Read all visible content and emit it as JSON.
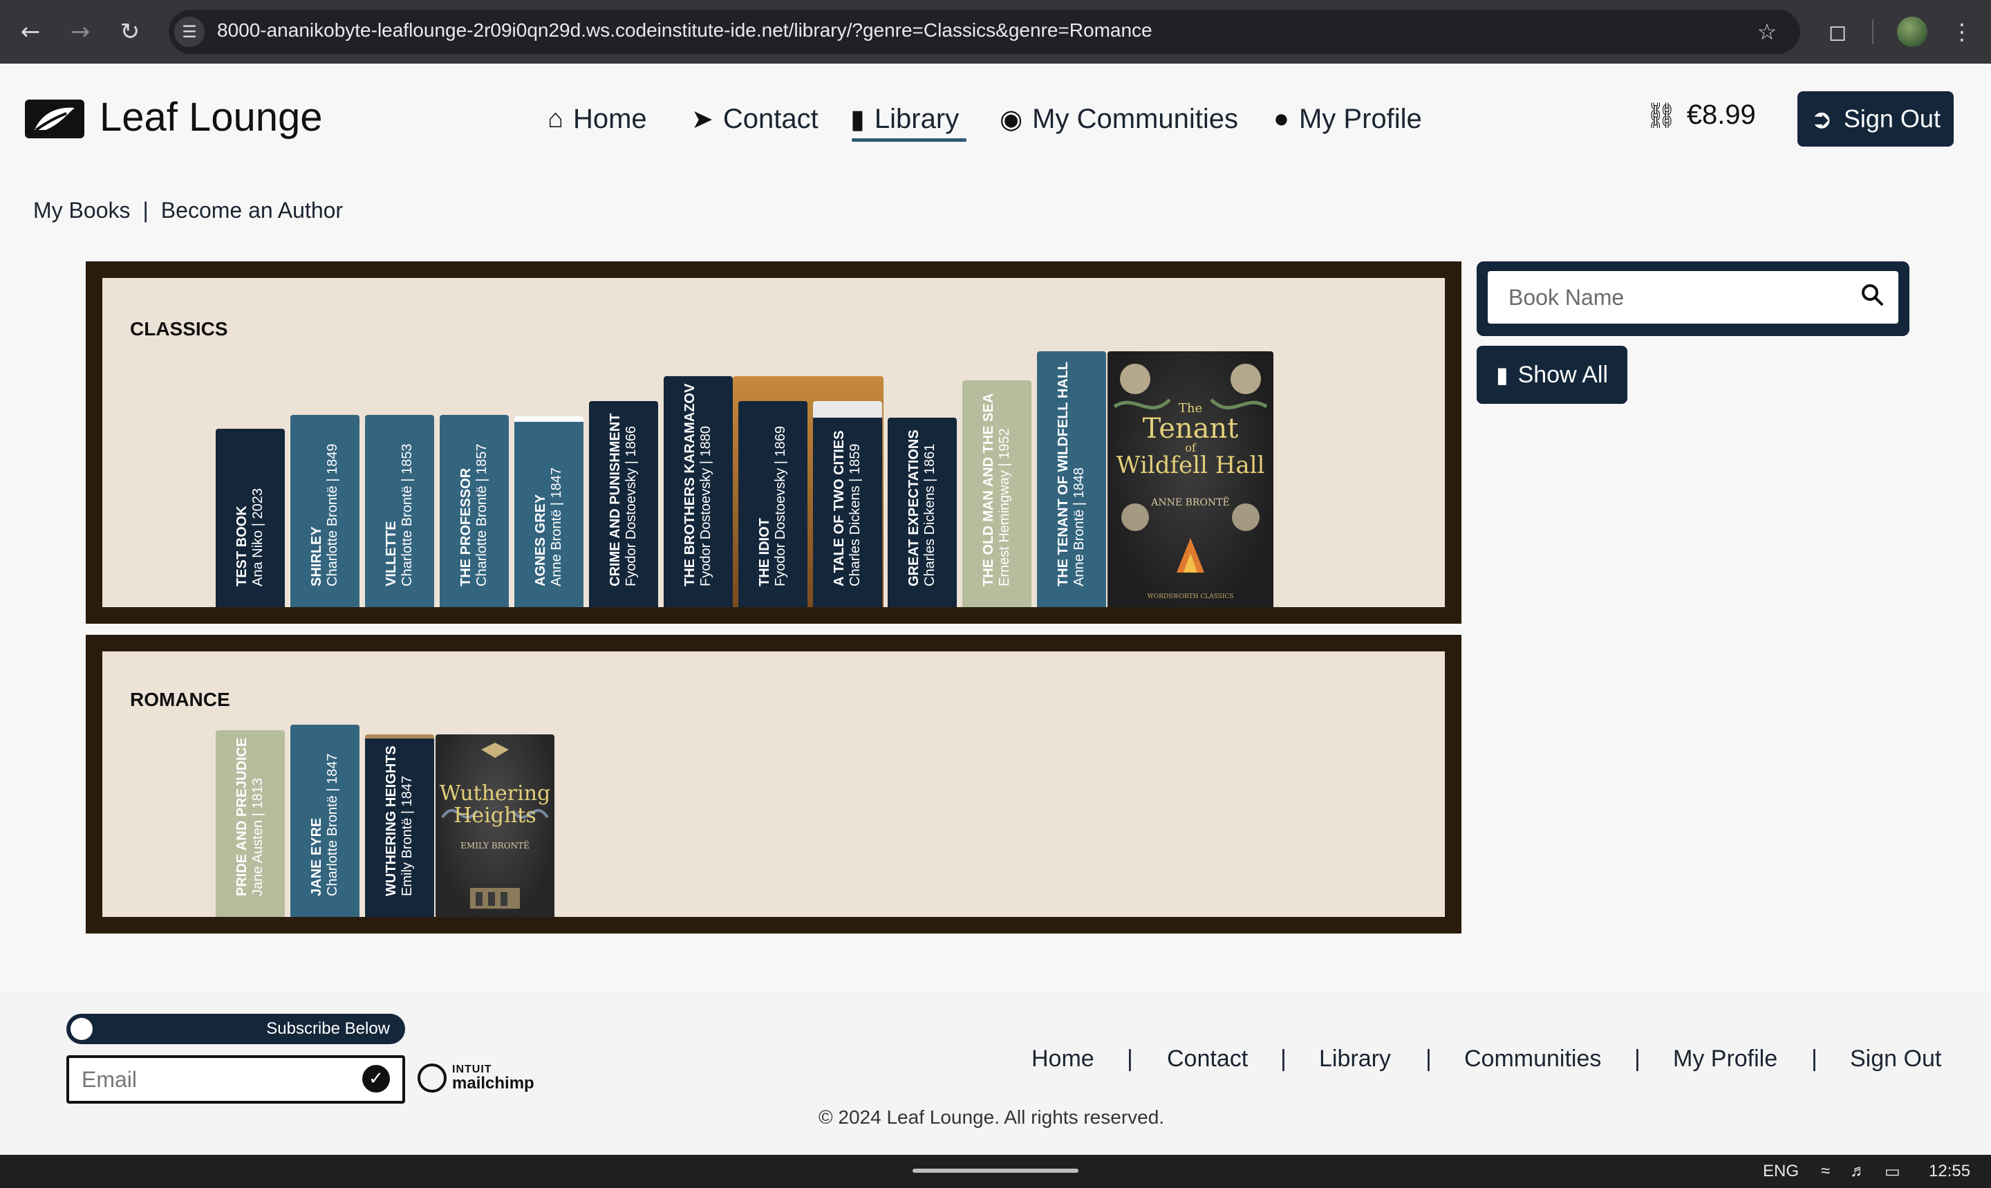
{
  "browser": {
    "url": "8000-ananikobyte-leaflounge-2r09i0qn29d.ws.codeinstitute-ide.net/library/?genre=Classics&genre=Romance"
  },
  "brand": {
    "name": "Leaf Lounge"
  },
  "nav": {
    "items": [
      {
        "label": "Home",
        "icon": "home-icon"
      },
      {
        "label": "Contact",
        "icon": "paper-plane-icon"
      },
      {
        "label": "Library",
        "icon": "book-icon"
      },
      {
        "label": "My Communities",
        "icon": "comments-icon"
      },
      {
        "label": "My Profile",
        "icon": "user-icon"
      }
    ],
    "active": "Library",
    "basket_total": "€8.99",
    "sign_out": "Sign Out"
  },
  "sub_links": {
    "my_books": "My Books",
    "separator": "|",
    "become_author": "Become an Author"
  },
  "shelves": [
    {
      "title": "CLASSICS",
      "books": [
        {
          "title": "TEST BOOK",
          "meta": "Ana Niko | 2023",
          "color": "#14263a"
        },
        {
          "title": "SHIRLEY",
          "meta": "Charlotte Brontë | 1849",
          "color": "#34657f"
        },
        {
          "title": "VILLETTE",
          "meta": "Charlotte Brontë | 1853",
          "color": "#34657f"
        },
        {
          "title": "THE PROFESSOR",
          "meta": "Charlotte Brontë | 1857",
          "color": "#34657f"
        },
        {
          "title": "AGNES GREY",
          "meta": "Anne Brontë | 1847",
          "color": "#34657f"
        },
        {
          "title": "CRIME AND PUNISHMENT",
          "meta": "Fyodor Dostoevsky | 1866",
          "color": "#14263a"
        },
        {
          "title": "THE BROTHERS KARAMAZOV",
          "meta": "Fyodor Dostoevsky | 1880",
          "color": "#14263a"
        },
        {
          "title": "THE IDIOT",
          "meta": "Fyodor Dostoevsky | 1869",
          "color": "#14263a"
        },
        {
          "title": "A TALE OF TWO CITIES",
          "meta": "Charles Dickens | 1859",
          "color": "#14263a"
        },
        {
          "title": "GREAT EXPECTATIONS",
          "meta": "Charles Dickens | 1861",
          "color": "#14263a"
        },
        {
          "title": "THE OLD MAN AND THE SEA",
          "meta": "Ernest Hemingway | 1952",
          "color": "#b5bd9d"
        },
        {
          "title": "THE TENANT OF WILDFELL HALL",
          "meta": "Anne Brontë | 1848",
          "color": "#34657f"
        }
      ],
      "cover": {
        "title_line1": "The",
        "title_line2": "Tenant",
        "title_line3": "of",
        "title_line4": "Wildfell Hall",
        "author": "ANNE BRONTË",
        "publisher": "WORDSWORTH CLASSICS"
      }
    },
    {
      "title": "ROMANCE",
      "books": [
        {
          "title": "PRIDE AND PREJUDICE",
          "meta": "Jane Austen | 1813",
          "color": "#b5bd9d"
        },
        {
          "title": "JANE EYRE",
          "meta": "Charlotte Brontë | 1847",
          "color": "#34657f"
        },
        {
          "title": "WUTHERING HEIGHTS",
          "meta": "Emily Brontë | 1847",
          "color": "#14263a"
        }
      ],
      "cover": {
        "title_line1": "Wuthering",
        "title_line2": "Heights",
        "author": "EMILY BRONTË"
      }
    }
  ],
  "search": {
    "placeholder": "Book Name",
    "show_all": "Show All"
  },
  "footer": {
    "subscribe": "Subscribe Below",
    "email_placeholder": "Email",
    "mailchimp_a": "INTUIT",
    "mailchimp_b": "mailchimp",
    "links": [
      "Home",
      "|",
      "Contact",
      "|",
      "Library",
      "|",
      "Communities",
      "|",
      "My Profile",
      "|",
      "Sign Out"
    ],
    "copyright": "© 2024 Leaf Lounge. All rights reserved."
  },
  "tray": {
    "lang": "ENG",
    "time": "12:55"
  }
}
